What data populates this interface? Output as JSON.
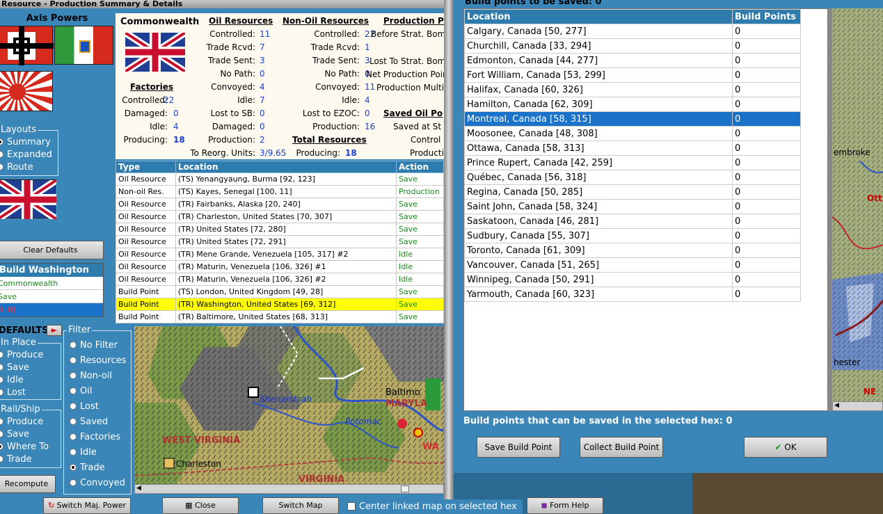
{
  "left_window": {
    "title": "Resource - Production Summary & Details",
    "axis_powers_label": "Axis Powers",
    "layouts": {
      "legend": "Layouts",
      "options": [
        "Summary",
        "Expanded",
        "Route"
      ],
      "selected": "Summary"
    },
    "clear_defaults_label": "Clear Defaults",
    "build_panel": {
      "header": "Build Washington",
      "lines": [
        "Commonwealth",
        "Save",
        "0, 0]"
      ]
    },
    "defaults_label": "DEFAULTS",
    "in_place": {
      "legend": "In Place",
      "options": [
        "Produce",
        "Save",
        "Idle",
        "Lost"
      ]
    },
    "rail_ship": {
      "legend": "Rail/Ship",
      "options": [
        "Produce",
        "Save",
        "Where To",
        "Trade"
      ],
      "selected": "Where To"
    },
    "filter": {
      "legend": "Filter",
      "options": [
        "No Filter",
        "Resources",
        "Non-oil",
        "Oil",
        "Lost",
        "Saved",
        "Factories",
        "Idle",
        "Trade",
        "Convoyed"
      ],
      "selected": "Trade"
    },
    "recompute_label": "Recompute",
    "summary": {
      "country": "Commonwealth",
      "factories": {
        "header": "Factories",
        "rows": [
          {
            "label": "Controlled:",
            "value": "22"
          },
          {
            "label": "Damaged:",
            "value": "0"
          },
          {
            "label": "Idle:",
            "value": "4"
          },
          {
            "label": "Producing:",
            "value": "18"
          }
        ]
      },
      "oil": {
        "header": "Oil Resources",
        "rows": [
          {
            "label": "Controlled:",
            "value": "11"
          },
          {
            "label": "Trade Rcvd:",
            "value": "7"
          },
          {
            "label": "Trade Sent:",
            "value": "3"
          },
          {
            "label": "No Path:",
            "value": "0"
          },
          {
            "label": "Convoyed:",
            "value": "4"
          },
          {
            "label": "Idle:",
            "value": "7"
          },
          {
            "label": "Lost to SB:",
            "value": "0"
          },
          {
            "label": "Damaged:",
            "value": "0"
          },
          {
            "label": "Production:",
            "value": "2"
          },
          {
            "label": "To Reorg. Units:",
            "value": "3/9.65"
          }
        ]
      },
      "nonoil": {
        "header": "Non-Oil Resources",
        "rows": [
          {
            "label": "Controlled:",
            "value": "22"
          },
          {
            "label": "Trade Rcvd:",
            "value": "1"
          },
          {
            "label": "Trade Sent:",
            "value": "3"
          },
          {
            "label": "No Path:",
            "value": "0"
          },
          {
            "label": "Convoyed:",
            "value": "11"
          },
          {
            "label": "Idle:",
            "value": "4"
          },
          {
            "label": "Lost to EZOC:",
            "value": "0"
          },
          {
            "label": "Production:",
            "value": "16"
          }
        ]
      },
      "total": {
        "header": "Total Resources",
        "label": "Producing:",
        "value": "18"
      },
      "production": {
        "header": "Production P",
        "rows": [
          "Before Strat. Bom",
          "Lost To Strat. Bom",
          "Net Production Poin",
          "Production Multip"
        ]
      },
      "saved_oil": {
        "header": "Saved Oil Po",
        "rows": [
          "Saved at St",
          "Control",
          "Producti"
        ]
      }
    },
    "table": {
      "columns": [
        "Type",
        "Location",
        "Action"
      ],
      "rows": [
        {
          "type": "Oil Resource",
          "location": "(TS) Yenangyaung, Burma [92, 123]",
          "action": "Save"
        },
        {
          "type": "Non-oil Res.",
          "location": "(TS) Kayes, Senegal [100, 11]",
          "action": "Production"
        },
        {
          "type": "Oil Resource",
          "location": "(TR) Fairbanks, Alaska [20, 240]",
          "action": "Save"
        },
        {
          "type": "Oil Resource",
          "location": "(TR) Charleston, United States [70, 307]",
          "action": "Save"
        },
        {
          "type": "Oil Resource",
          "location": "(TR) United States [72, 280]",
          "action": "Save"
        },
        {
          "type": "Oil Resource",
          "location": "(TR) United States [72, 291]",
          "action": "Save"
        },
        {
          "type": "Oil Resource",
          "location": "(TR) Mene Grande, Venezuela [105, 317] #2",
          "action": "Idle"
        },
        {
          "type": "Oil Resource",
          "location": "(TR) Maturin, Venezuela [106, 326] #1",
          "action": "Idle"
        },
        {
          "type": "Oil Resource",
          "location": "(TR) Maturin, Venezuela [106, 326] #2",
          "action": "Idle"
        },
        {
          "type": "Build Point",
          "location": "(TS) London, United Kingdom [49, 28]",
          "action": "Save"
        },
        {
          "type": "Build Point",
          "location": "(TR) Washington, United States [69, 312]",
          "action": "Save"
        },
        {
          "type": "Build Point",
          "location": "(TR) Baltimore, United States [68, 313]",
          "action": "Save"
        }
      ],
      "selected_index": 10
    },
    "map_labels": {
      "shenandoah": "Shenandoah",
      "potomac": "Potomac",
      "baltimore": "Baltimo",
      "maryland": "MARYLA",
      "west_virginia": "WEST VIRGINIA",
      "charleston": "Charleston",
      "virginia": "VIRGINIA",
      "wa": "WA"
    }
  },
  "right_window": {
    "title_fragment": "Build points to be saved: 0",
    "columns": [
      "Location",
      "Build Points"
    ],
    "rows": [
      {
        "location": "Calgary, Canada [50, 277]",
        "points": "0"
      },
      {
        "location": "Churchill, Canada [33, 294]",
        "points": "0"
      },
      {
        "location": "Edmonton, Canada [44, 277]",
        "points": "0"
      },
      {
        "location": "Fort William, Canada [53, 299]",
        "points": "0"
      },
      {
        "location": "Halifax, Canada [60, 326]",
        "points": "0"
      },
      {
        "location": "Hamilton, Canada [62, 309]",
        "points": "0"
      },
      {
        "location": "Montreal, Canada [58, 315]",
        "points": "0"
      },
      {
        "location": "Moosonee, Canada [48, 308]",
        "points": "0"
      },
      {
        "location": "Ottawa, Canada [58, 313]",
        "points": "0"
      },
      {
        "location": "Prince Rupert, Canada [42, 259]",
        "points": "0"
      },
      {
        "location": "Québec, Canada [56, 318]",
        "points": "0"
      },
      {
        "location": "Regina, Canada [50, 285]",
        "points": "0"
      },
      {
        "location": "Saint John, Canada [58, 324]",
        "points": "0"
      },
      {
        "location": "Saskatoon, Canada [46, 281]",
        "points": "0"
      },
      {
        "location": "Sudbury, Canada [55, 307]",
        "points": "0"
      },
      {
        "location": "Toronto, Canada [61, 309]",
        "points": "0"
      },
      {
        "location": "Vancouver, Canada [51, 265]",
        "points": "0"
      },
      {
        "location": "Winnipeg, Canada [50, 291]",
        "points": "0"
      },
      {
        "location": "Yarmouth, Canada [60, 323]",
        "points": "0"
      }
    ],
    "selected_index": 6,
    "status_text": "Build points that can be saved in the selected hex:  0",
    "save_button": "Save Build Point",
    "collect_button": "Collect Build Point",
    "ok_button": "OK",
    "map_labels": {
      "embroke": "embroke",
      "chester": "hester",
      "ott": "Ott",
      "ne": "NE"
    }
  },
  "bottom_bar": {
    "switch_major_power": "Switch Maj. Power",
    "close": "Close",
    "switch_map": "Switch Map",
    "center_linked": "Center linked map on selected hex",
    "form_help": "Form Help"
  }
}
